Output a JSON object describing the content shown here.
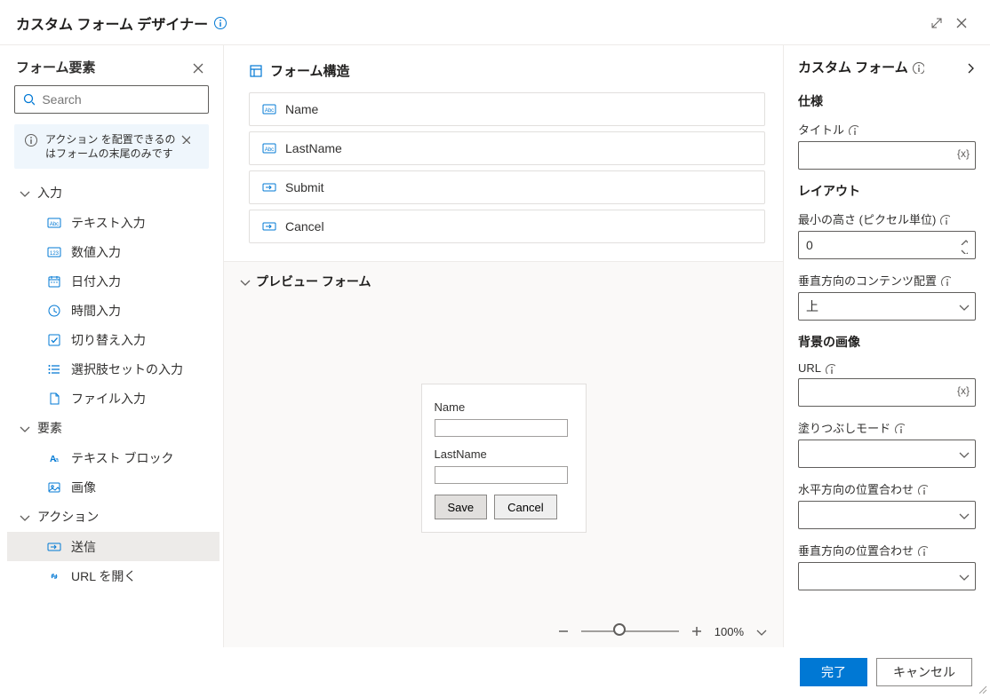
{
  "titlebar": {
    "title": "カスタム フォーム デザイナー"
  },
  "left": {
    "title": "フォーム要素",
    "search_placeholder": "Search",
    "info_message": "アクション を配置できるのはフォームの末尾のみです",
    "groups": {
      "input": {
        "label": "入力",
        "items": [
          {
            "label": "テキスト入力",
            "icon": "text-abc-icon"
          },
          {
            "label": "数値入力",
            "icon": "number-123-icon"
          },
          {
            "label": "日付入力",
            "icon": "calendar-icon"
          },
          {
            "label": "時間入力",
            "icon": "clock-icon"
          },
          {
            "label": "切り替え入力",
            "icon": "checkbox-icon"
          },
          {
            "label": "選択肢セットの入力",
            "icon": "list-icon"
          },
          {
            "label": "ファイル入力",
            "icon": "file-icon"
          }
        ]
      },
      "elements": {
        "label": "要素",
        "items": [
          {
            "label": "テキスト ブロック",
            "icon": "text-aa-icon"
          },
          {
            "label": "画像",
            "icon": "image-icon"
          }
        ]
      },
      "actions": {
        "label": "アクション",
        "items": [
          {
            "label": "送信",
            "icon": "submit-icon",
            "selected": true
          },
          {
            "label": "URL を開く",
            "icon": "link-icon"
          }
        ]
      }
    }
  },
  "center": {
    "struct_title": "フォーム構造",
    "struct_items": [
      {
        "label": "Name",
        "icon": "text-abc-icon"
      },
      {
        "label": "LastName",
        "icon": "text-abc-icon"
      },
      {
        "label": "Submit",
        "icon": "submit-icon"
      },
      {
        "label": "Cancel",
        "icon": "submit-icon"
      }
    ],
    "preview_title": "プレビュー フォーム",
    "preview": {
      "name_label": "Name",
      "lastname_label": "LastName",
      "save": "Save",
      "cancel": "Cancel"
    },
    "zoom": "100%"
  },
  "right": {
    "title": "カスタム フォーム",
    "spec_title": "仕様",
    "title_label": "タイトル",
    "title_value": "",
    "layout_title": "レイアウト",
    "minheight_label": "最小の高さ (ピクセル単位)",
    "minheight_value": "0",
    "valign_label": "垂直方向のコンテンツ配置",
    "valign_value": "上",
    "bg_title": "背景の画像",
    "url_label": "URL",
    "url_value": "",
    "fillmode_label": "塗りつぶしモード",
    "fillmode_value": "",
    "halign_label": "水平方向の位置合わせ",
    "halign_value": "",
    "bgvalign_label": "垂直方向の位置合わせ",
    "bgvalign_value": ""
  },
  "footer": {
    "done": "完了",
    "cancel": "キャンセル"
  }
}
